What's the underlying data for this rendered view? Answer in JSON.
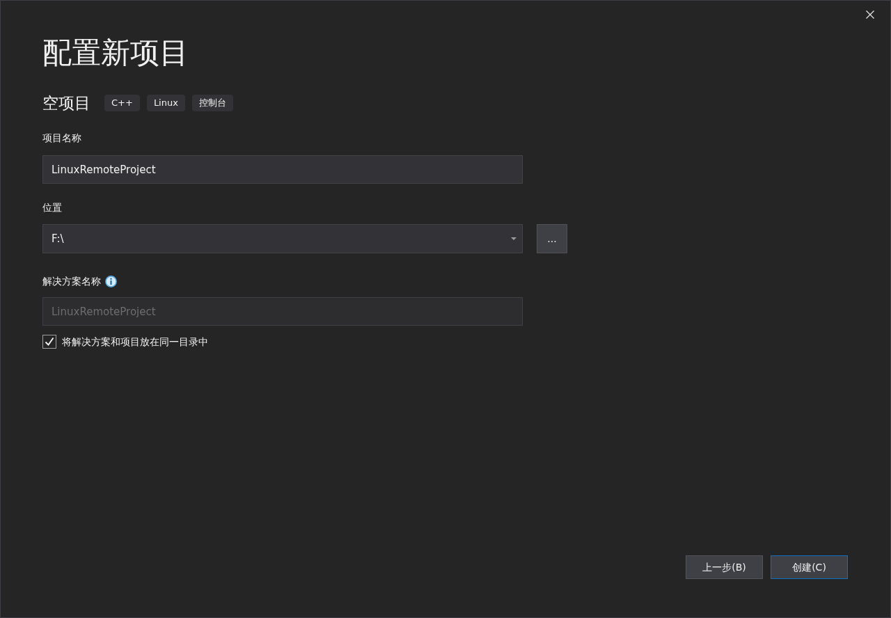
{
  "title": "配置新项目",
  "template": {
    "name": "空项目",
    "tags": [
      "C++",
      "Linux",
      "控制台"
    ]
  },
  "fields": [
    {
      "kind": "text",
      "label": "项目名称",
      "info": false,
      "value": "LinuxRemoteProject",
      "disabled": false
    },
    {
      "kind": "combo",
      "label": "位置",
      "info": false,
      "value": "F:\\",
      "disabled": false,
      "browse_label": "..."
    },
    {
      "kind": "text",
      "label": "解决方案名称",
      "info": true,
      "value": "LinuxRemoteProject",
      "disabled": true
    }
  ],
  "checkbox": {
    "label": "将解决方案和项目放在同一目录中",
    "checked": true
  },
  "buttons": [
    {
      "label": "上一步(B)",
      "default": false
    },
    {
      "label": "创建(C)",
      "default": true
    }
  ]
}
